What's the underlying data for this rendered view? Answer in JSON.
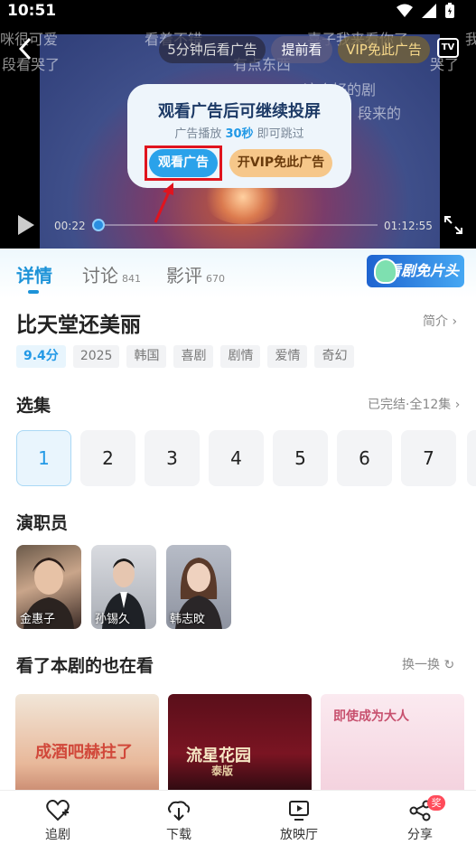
{
  "status": {
    "time": "10:51"
  },
  "player": {
    "danmu": [
      "咪很可爱",
      "段看哭了",
      "看着不错",
      "喜子我来看你了",
      "有点东西",
      "这个好的剧",
      "段来的",
      "哭了",
      "我"
    ],
    "countdown_label": "5分钟后看广告",
    "early_label": "提前看",
    "vip_label": "VIP免此广告",
    "tv_label": "TV",
    "current_time": "00:22",
    "total_time": "01:12:55",
    "progress": 0.02
  },
  "ad_popup": {
    "title": "观看广告后可继续投屏",
    "sub_prefix": "广告播放 ",
    "sub_seconds": "30秒",
    "sub_suffix": " 即可跳过",
    "watch_label": "观看广告",
    "vip_label": "开VIP免此广告"
  },
  "tabs": [
    {
      "label": "详情",
      "count": ""
    },
    {
      "label": "讨论",
      "count": "841"
    },
    {
      "label": "影评",
      "count": "670"
    }
  ],
  "banner_label": "看剧免片头",
  "show": {
    "title": "比天堂还美丽",
    "intro_label": "简介",
    "tags": [
      "9.4分",
      "2025",
      "韩国",
      "喜剧",
      "剧情",
      "爱情",
      "奇幻"
    ]
  },
  "episodes": {
    "title": "选集",
    "status": "已完结·全12集",
    "items": [
      "1",
      "2",
      "3",
      "4",
      "5",
      "6",
      "7"
    ],
    "selected": "1"
  },
  "cast": {
    "title": "演职员",
    "actors": [
      "金惠子",
      "孙锡久",
      "韩志旼"
    ]
  },
  "recommend": {
    "title": "看了本剧的也在看",
    "refresh_label": "换一换",
    "items": [
      {
        "title": "成酒吧赫拄了"
      },
      {
        "title": "流星花园",
        "sub": "泰版"
      },
      {
        "title": "即使成为大人"
      }
    ]
  },
  "bottom_nav": [
    {
      "label": "追剧",
      "icon": "heart-plus-icon"
    },
    {
      "label": "下载",
      "icon": "download-icon"
    },
    {
      "label": "放映厅",
      "icon": "screening-room-icon"
    },
    {
      "label": "分享",
      "icon": "share-icon",
      "badge": "奖"
    }
  ]
}
